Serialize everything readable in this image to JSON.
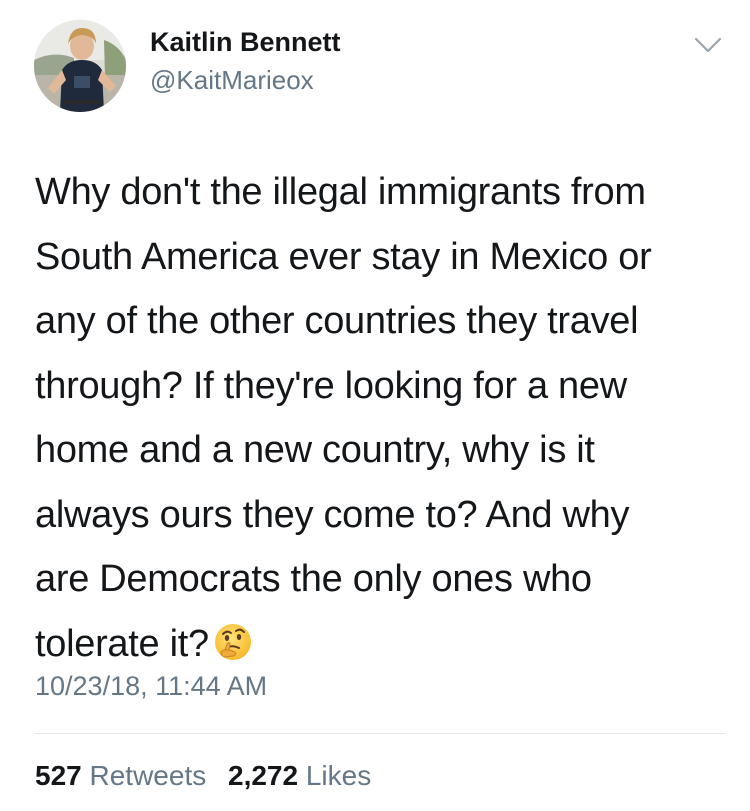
{
  "author": {
    "display_name": "Kaitlin Bennett",
    "handle": "@KaitMarieox",
    "avatar_icon": "profile-photo",
    "menu_icon": "chevron-down-icon"
  },
  "tweet": {
    "text_lines": [
      "Why don't the illegal immigrants from",
      "South America ever stay in Mexico or",
      "any of the other countries they travel",
      "through? If they're looking for a new",
      "home and a new country, why is it",
      "always ours they come to? And why",
      "are Democrats the only ones who",
      "tolerate it?"
    ],
    "emoji": "thinking-face-emoji",
    "timestamp": "10/23/18, 11:44 AM"
  },
  "stats": {
    "retweets_count": "527",
    "retweets_label": "Retweets",
    "likes_count": "2,272",
    "likes_label": "Likes"
  },
  "colors": {
    "text": "#14171a",
    "secondary": "#657786",
    "divider": "#e1e8ed"
  }
}
